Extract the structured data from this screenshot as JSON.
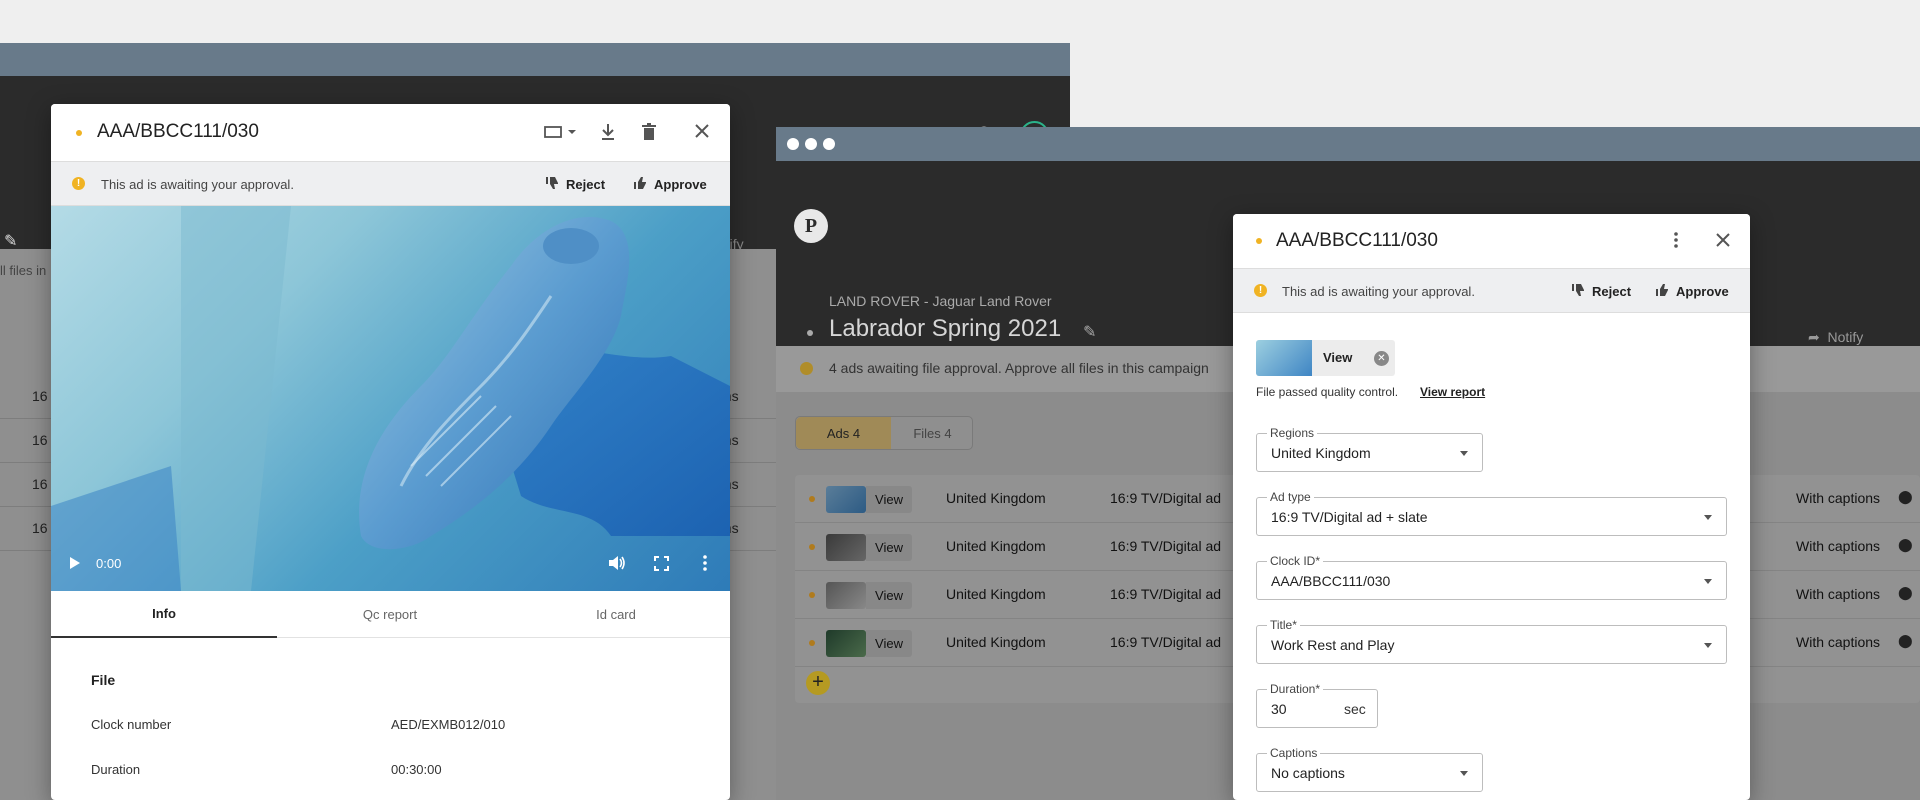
{
  "window1": {
    "avatar_initials": "PS",
    "notify_fragment": "otify",
    "files_fragment": "ll files in",
    "rows": [
      {
        "c1": "16",
        "c2": "ons"
      },
      {
        "c1": "16",
        "c2": "ons"
      },
      {
        "c1": "16",
        "c2": "ons"
      },
      {
        "c1": "16",
        "c2": "ons"
      }
    ]
  },
  "window2": {
    "logo": "P",
    "client": "LAND ROVER - Jaguar Land Rover",
    "campaign_title": "Labrador Spring 2021",
    "notify_label": "Notify",
    "banner_text": "4 ads awaiting file approval. Approve all files in this campaign",
    "tabs": {
      "ads": "Ads 4",
      "files": "Files 4"
    },
    "rows": [
      {
        "view": "View",
        "region": "United Kingdom",
        "format": "16:9 TV/Digital ad",
        "captions": "With captions"
      },
      {
        "view": "View",
        "region": "United Kingdom",
        "format": "16:9 TV/Digital ad",
        "captions": "With captions"
      },
      {
        "view": "View",
        "region": "United Kingdom",
        "format": "16:9 TV/Digital ad",
        "captions": "With captions"
      },
      {
        "view": "View",
        "region": "United Kingdom",
        "format": "16:9 TV/Digital ad",
        "captions": "With captions"
      }
    ]
  },
  "modal1": {
    "title": "AAA/BBCC111/030",
    "approval_text": "This ad is awaiting your approval.",
    "reject_label": "Reject",
    "approve_label": "Approve",
    "video_time": "0:00",
    "tabs": [
      "Info",
      "Qc report",
      "Id card"
    ],
    "section_title": "File",
    "info": [
      {
        "label": "Clock number",
        "value": "AED/EXMB012/010"
      },
      {
        "label": "Duration",
        "value": "00:30:00"
      }
    ]
  },
  "modal2": {
    "title": "AAA/BBCC111/030",
    "approval_text": "This ad is awaiting your approval.",
    "reject_label": "Reject",
    "approve_label": "Approve",
    "file_view_label": "View",
    "qc_text": "File passed quality control.",
    "view_report_label": "View report",
    "fields": {
      "regions": {
        "label": "Regions",
        "value": "United Kingdom"
      },
      "ad_type": {
        "label": "Ad type",
        "value": "16:9 TV/Digital ad + slate"
      },
      "clock_id": {
        "label": "Clock ID*",
        "value": "AAA/BBCC111/030"
      },
      "title": {
        "label": "Title*",
        "value": "Work Rest and Play"
      },
      "duration": {
        "label": "Duration*",
        "value": "30",
        "unit": "sec"
      },
      "captions": {
        "label": "Captions",
        "value": "No captions"
      }
    }
  }
}
